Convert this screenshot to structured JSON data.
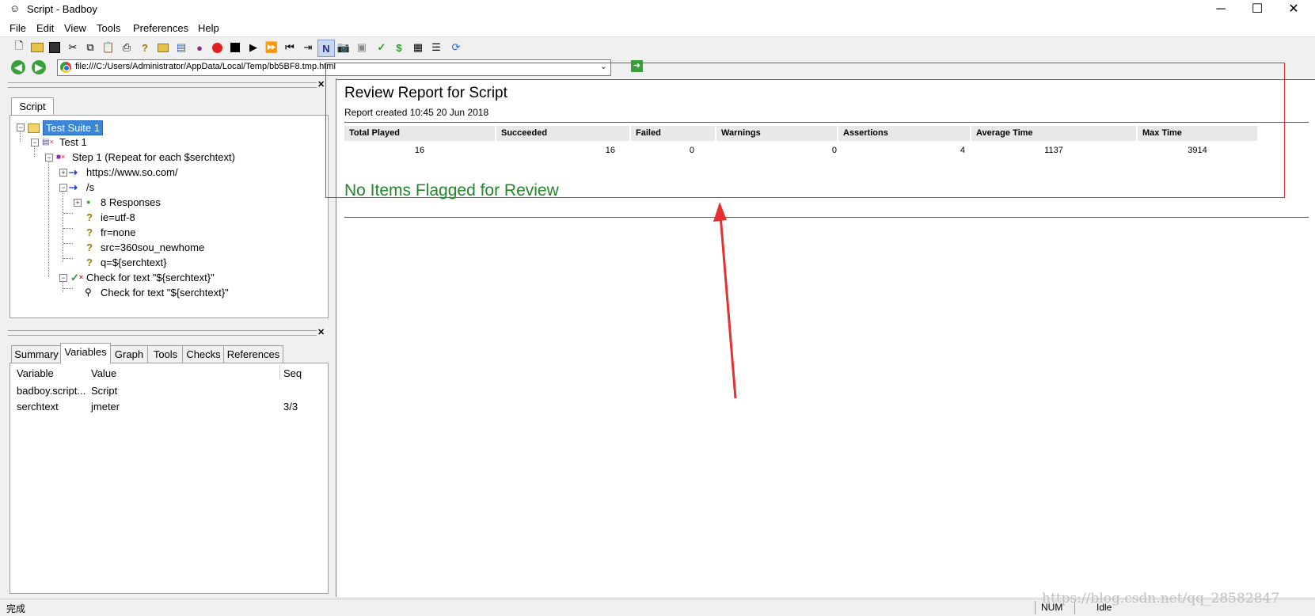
{
  "window": {
    "title": "Script - Badboy",
    "controls": {
      "minimize": "─",
      "maximize": "☐",
      "close": "✕"
    }
  },
  "menu": [
    "File",
    "Edit",
    "View",
    "Tools",
    "Preferences",
    "Help"
  ],
  "toolbar_icons": [
    "new-icon",
    "open-icon",
    "save-icon",
    "cut-icon",
    "copy-icon",
    "paste-icon",
    "print-icon",
    "help-icon",
    "add-folder-icon",
    "add-step-icon",
    "add-item-icon",
    "record-icon",
    "stop-icon",
    "play-icon",
    "fast-forward-icon",
    "rewind-icon",
    "step-icon",
    "navigation-mode-icon",
    "screenshot-icon",
    "capture-icon",
    "check-icon",
    "variable-icon",
    "table-icon",
    "tree-icon",
    "refresh-icon"
  ],
  "address": {
    "url": "file:///C:/Users/Administrator/AppData/Local/Temp/bb5BF8.tmp.html"
  },
  "script_panel": {
    "tab": "Script",
    "tree": [
      {
        "label": "Test Suite 1",
        "selected": true
      },
      {
        "label": "Test 1"
      },
      {
        "label": "Step 1 (Repeat for each $serchtext)"
      },
      {
        "label": "https://www.so.com/"
      },
      {
        "label": "/s"
      },
      {
        "label": "8 Responses"
      },
      {
        "label": "ie=utf-8"
      },
      {
        "label": "fr=none"
      },
      {
        "label": "src=360sou_newhome"
      },
      {
        "label": "q=${serchtext}"
      },
      {
        "label": "Check for text \"${serchtext}\""
      },
      {
        "label": "Check for text \"${serchtext}\""
      }
    ]
  },
  "bottom_panel": {
    "tabs": [
      "Summary",
      "Variables",
      "Graph",
      "Tools",
      "Checks",
      "References"
    ],
    "active_tab": "Variables",
    "columns": [
      "Variable",
      "Value",
      "Seq"
    ],
    "rows": [
      {
        "variable": "badboy.script...",
        "value": "Script",
        "seq": ""
      },
      {
        "variable": "serchtext",
        "value": "jmeter",
        "seq": "3/3"
      }
    ]
  },
  "report": {
    "title": "Review Report for Script",
    "created": "Report created 10:45 20 Jun 2018",
    "headers": [
      "Total Played",
      "Succeeded",
      "Failed",
      "Warnings",
      "Assertions",
      "Average Time",
      "Max Time"
    ],
    "values": [
      "16",
      "16",
      "0",
      "0",
      "4",
      "1137",
      "3914"
    ],
    "no_items": "No Items Flagged for Review",
    "highlight_color": "#e63030"
  },
  "status": {
    "left": "完成",
    "num": "NUM",
    "state": "Idle"
  },
  "watermark": "https://blog.csdn.net/qq_28582847"
}
